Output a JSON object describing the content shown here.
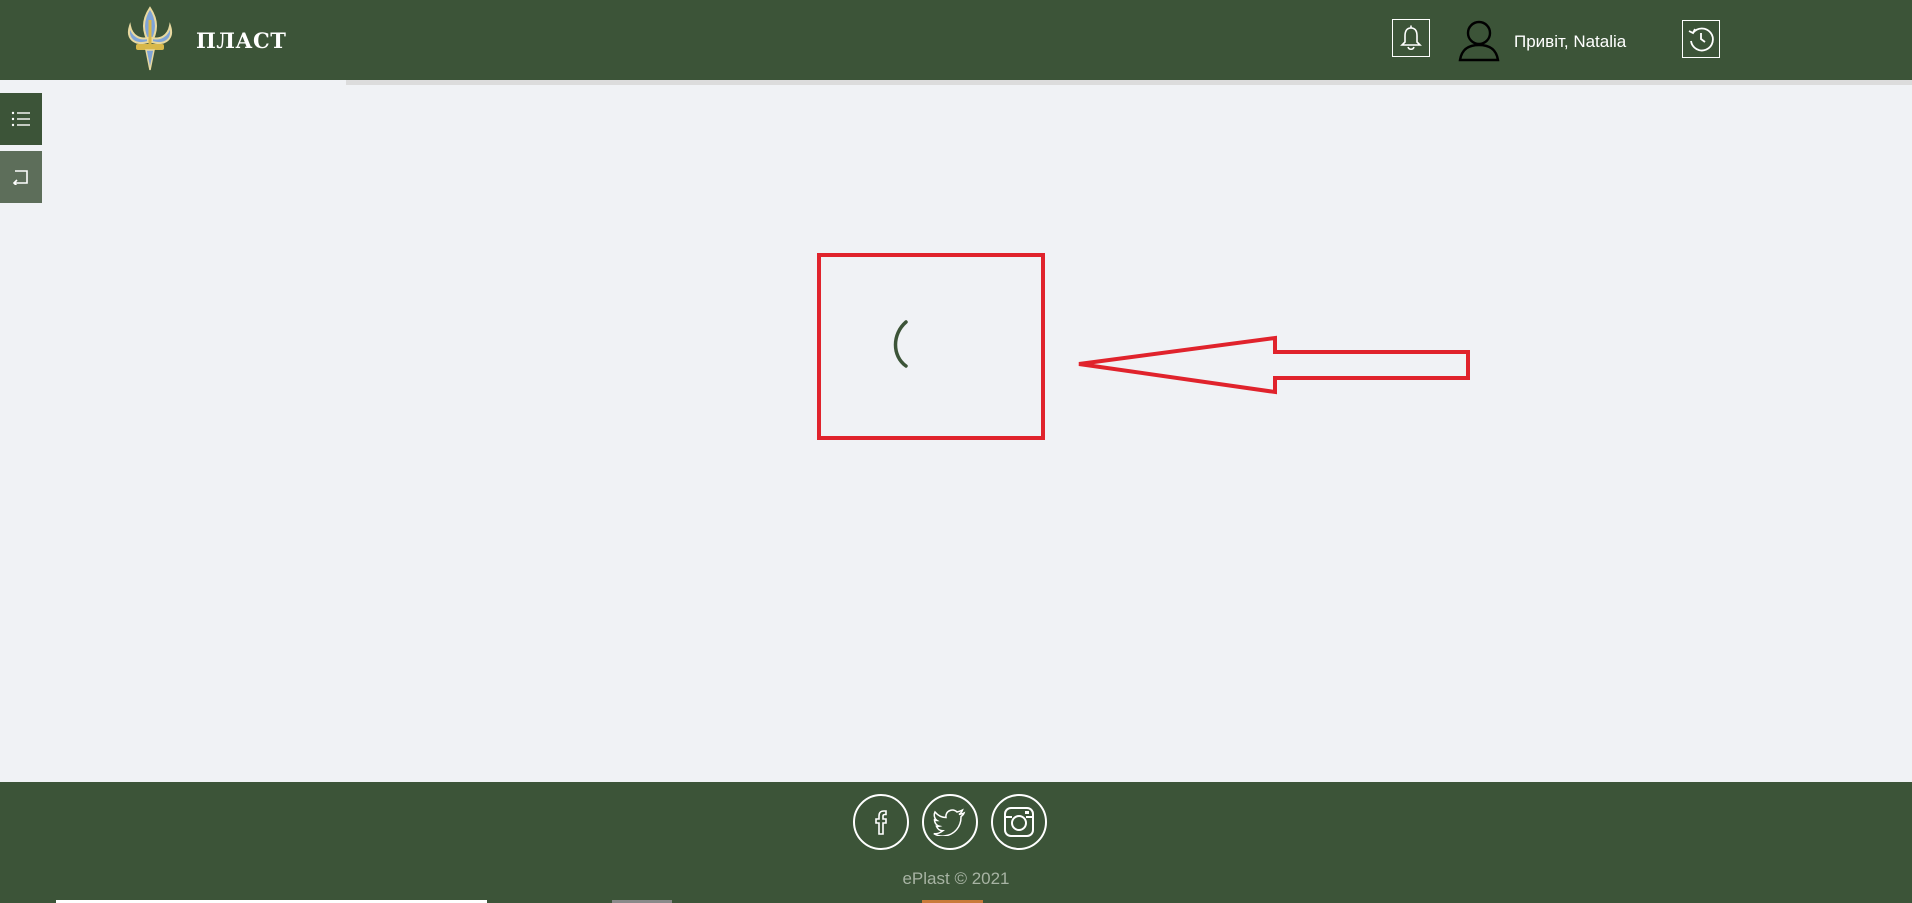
{
  "header": {
    "brand": "ПЛАСТ",
    "greeting": "Привіт, Natalia",
    "icons": [
      "fleur-de-lis-logo",
      "bell-icon",
      "user-icon",
      "history-icon"
    ]
  },
  "sidebar": {
    "icons": [
      "list-icon",
      "back-icon"
    ]
  },
  "main": {
    "state": "loading",
    "spinner_color": "#3c5438",
    "annotation_color": "#e0232c"
  },
  "footer": {
    "social": [
      "facebook-icon",
      "twitter-icon",
      "instagram-icon"
    ],
    "copyright": "ePlast © 2021"
  },
  "colors": {
    "primary": "#3c5438",
    "background": "#f0f2f5",
    "sidebar_secondary": "#5d6e5a"
  }
}
